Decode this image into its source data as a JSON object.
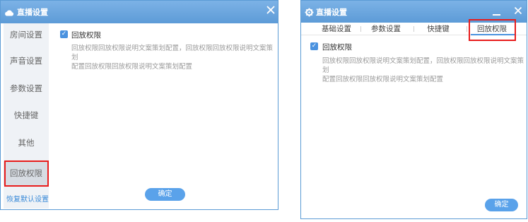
{
  "left_window": {
    "title": "直播设置",
    "sidebar": {
      "items": [
        {
          "label": "房间设置"
        },
        {
          "label": "声音设置"
        },
        {
          "label": "参数设置"
        },
        {
          "label": "快捷键"
        },
        {
          "label": "其他"
        },
        {
          "label": "回放权限",
          "active": true
        }
      ],
      "restore_label": "恢复默认设置"
    },
    "checkbox": {
      "label": "回放权限",
      "checked": true
    },
    "description_lines": [
      "回放权限回放权限说明文案策划配置，回放权限回放权限说明文案策划",
      "配置回放权限回放权限说明文案策划配置"
    ],
    "ok_label": "确定"
  },
  "right_window": {
    "title": "直播设置",
    "tabs": [
      {
        "label": "基础设置"
      },
      {
        "label": "参数设置"
      },
      {
        "label": "快捷键"
      },
      {
        "label": "回放权限",
        "active": true
      }
    ],
    "checkbox": {
      "label": "回放权限",
      "checked": true
    },
    "description_lines": [
      "回放权限回放权限说明文案策划配置，回放权限回放权限说明文案策划",
      "配置回放权限回放权限说明文案策划配置"
    ],
    "ok_label": "确定"
  },
  "colors": {
    "titlebar": "#5d9bd7",
    "accent": "#4a92df",
    "highlight_box": "#e81c1c",
    "link": "#3a8ad8"
  },
  "icons": {
    "left_title": "cloud-icon",
    "right_title": "gear-icon"
  }
}
